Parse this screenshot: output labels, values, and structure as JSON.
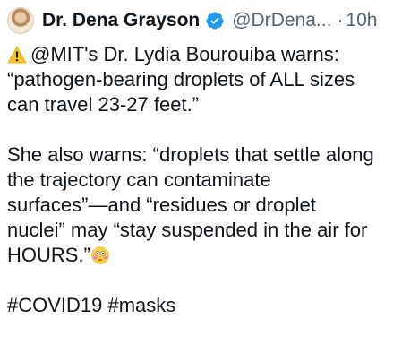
{
  "tweet": {
    "author": {
      "display_name": "Dr. Dena Grayson",
      "handle": "@DrDena...",
      "separator": "·",
      "time": "10h",
      "avatar_icon": "author-avatar",
      "verified_icon": "verified-badge-icon"
    },
    "lines": [
      "@MIT's Dr. Lydia Bourouiba warns:",
      "“pathogen-bearing droplets of ALL sizes",
      "can travel 23-27 feet.”",
      "She also warns: “droplets that settle along",
      "the trajectory can contaminate",
      "surfaces”—and “residues or droplet",
      "nuclei” may “stay suspended in the air for",
      "HOURS.”",
      "#COVID19 #masks"
    ],
    "icons": {
      "warning": "warning-icon",
      "flushed_face": "flushed-face-icon"
    },
    "colors": {
      "text": "#0f1419",
      "secondary": "#536471",
      "verified": "#1d9bf0"
    }
  }
}
